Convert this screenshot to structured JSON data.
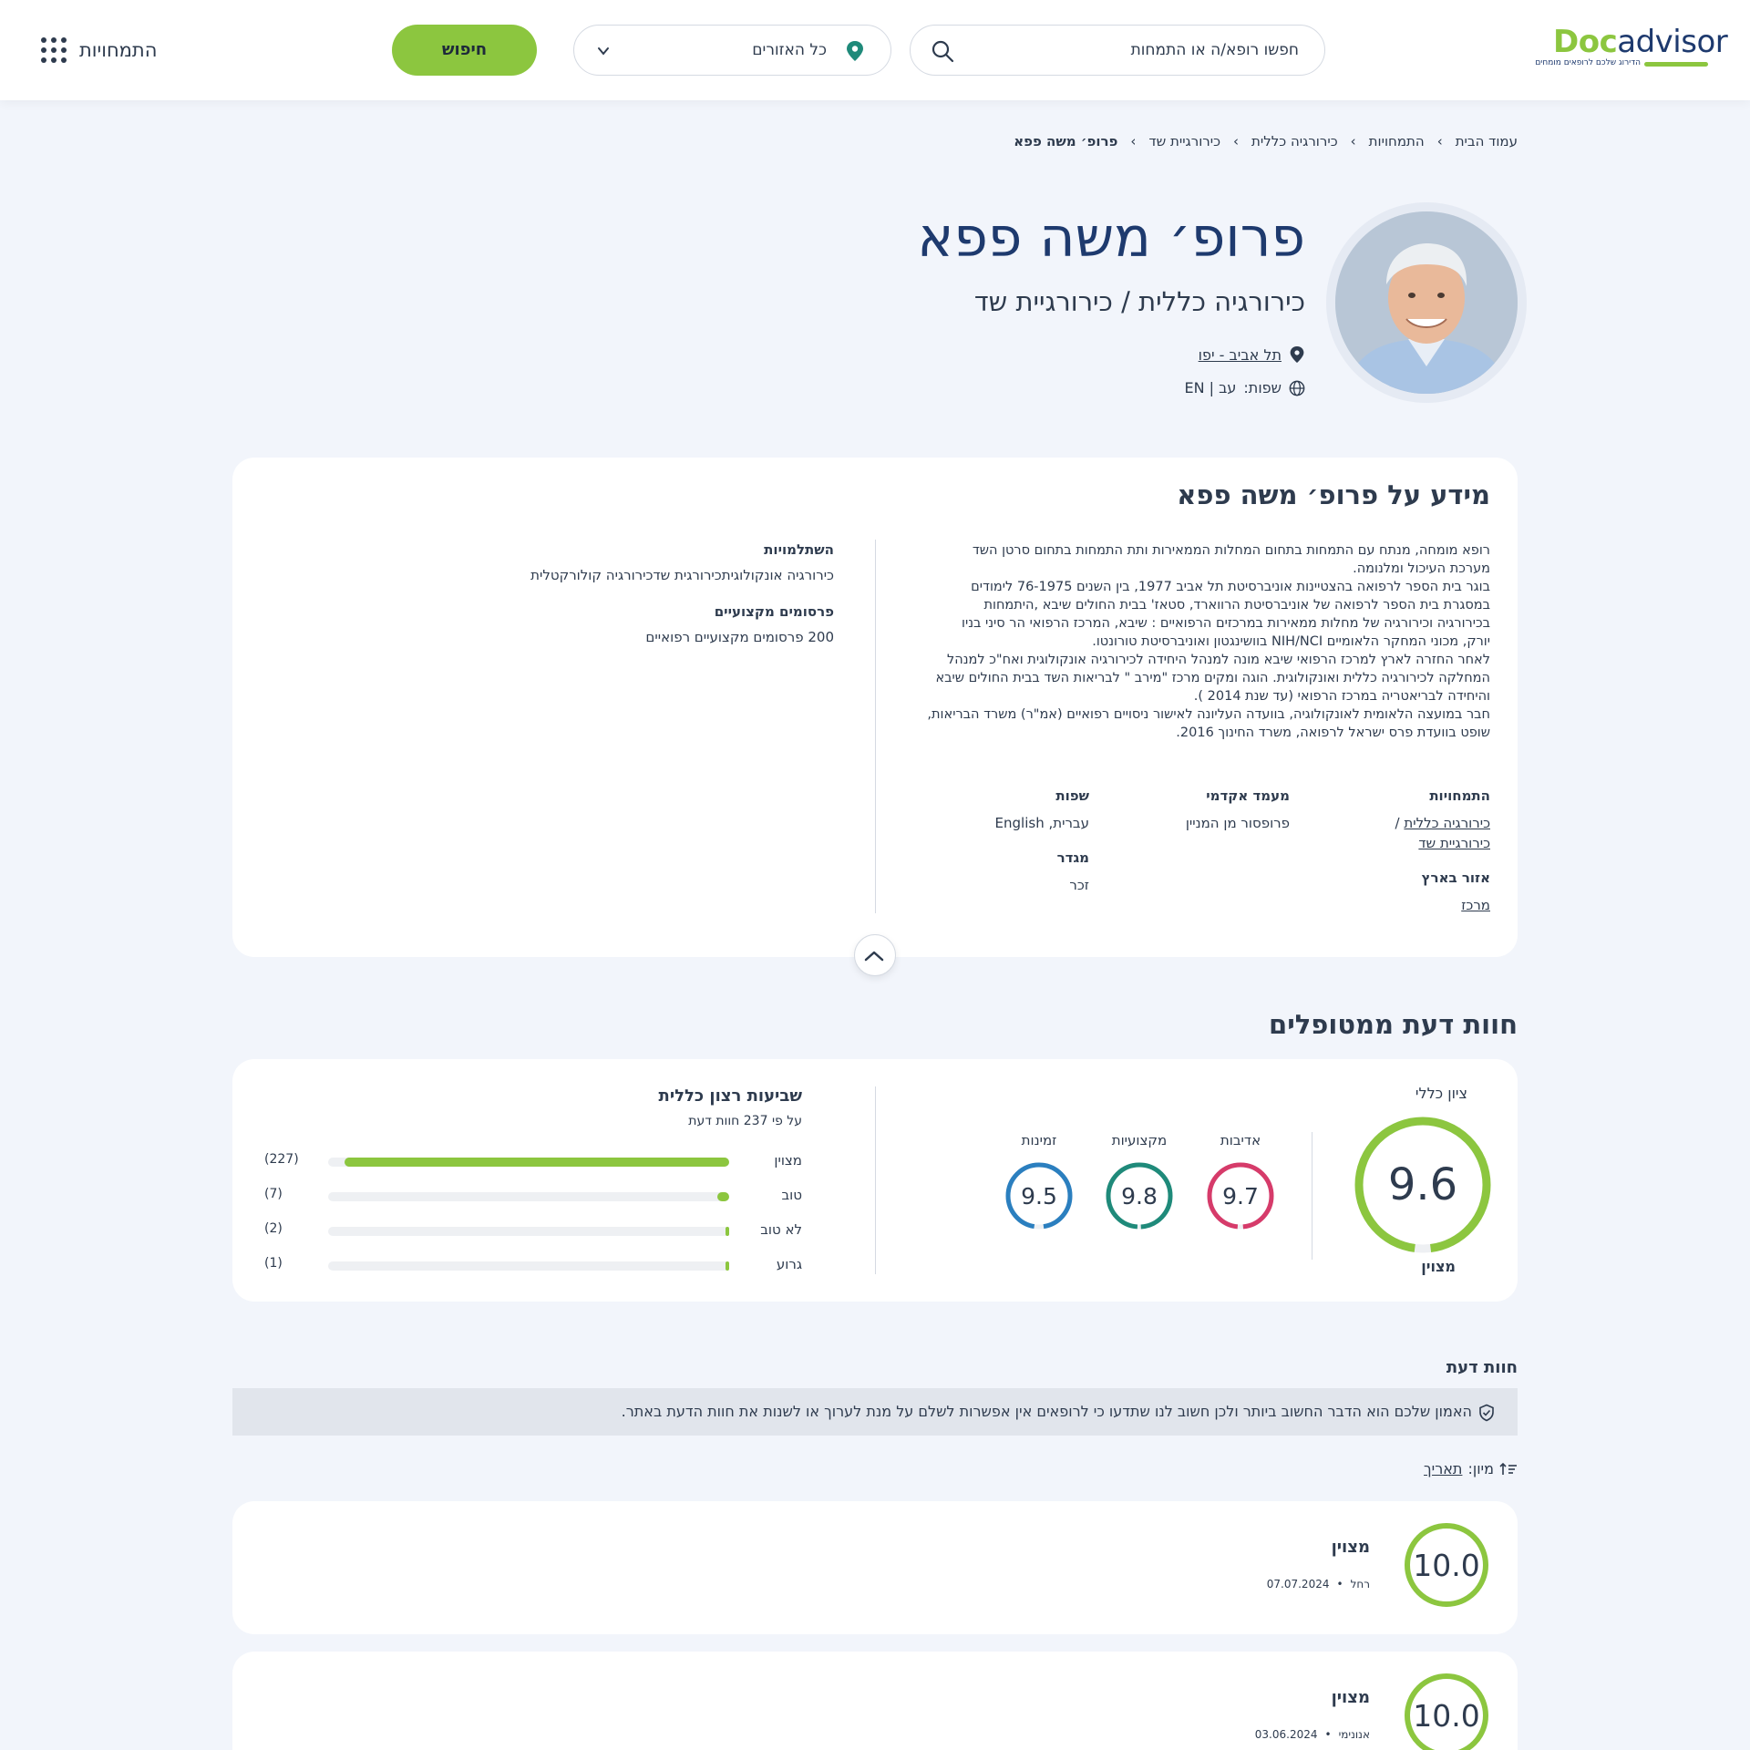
{
  "header": {
    "logo_part1": "Doc",
    "logo_part2": "advisor",
    "logo_tagline": "הדירוג שלכם לרופאים מומחים",
    "search_placeholder": "חפשו רופא/ה או התמחות",
    "region_value": "כל האזורים",
    "search_button": "חיפוש",
    "specialties_menu": "התמחויות"
  },
  "breadcrumb": [
    "עמוד הבית",
    "התמחויות",
    "כירורגיה כללית",
    "כירורגיית שד",
    "פרופ׳ משה פפא"
  ],
  "doctor": {
    "name": "פרופ׳ משה פפא",
    "specialty": "כירורגיה כללית / כירורגיית שד",
    "location": "תל אביב - יפו",
    "languages_label": "שפות:",
    "languages_value": "עב | EN"
  },
  "info": {
    "title": "מידע על פרופ׳ משה פפא",
    "bio": [
      "רופא מומחה, מנתח עם התמחות בתחום המחלות הממאירות ותת התמחות בתחום סרטן השד",
      "מערכת העיכול ומלנומה.",
      "בוגר בית הספר לרפואה בהצטיינות אוניברסיטת תל אביב 1977, בין השנים 76-1975 לימודים",
      "במסגרת בית הספר לרפואה של אוניברסיטת הרווארד, סטאז' בבית החולים שיבא ,היתמחות",
      "בכירורגיה וכירורגיה של מחלות ממאירות במרכזים הרפואיים : שיבא, המרכז הרפואי הר סיני בניו",
      "יורק, מכוני המחקר הלאומיים NIH/NCI בוושינגטון ואוניברסיטת טורונטו.",
      "לאחר החזרה לארץ למרכז הרפואי שיבא מונה למנהל היחידה לכירורגיה אונקולוגית ואח\"כ למנהל",
      "המחלקה לכירורגיה כללית ואונקולוגית. הוגה ומקים מרכז \"מירב \" לבריאות השד בבית החולים שיבא",
      "והיחידה לבריאטריה במרכז הרפואי (עד שנת 2014 ).",
      "חבר במועצה הלאומית לאונקולוגיה, בוועדה העליונה לאישור ניסויים רפואיים (אמ\"ר) משרד הבריאות,",
      "שופט בוועדת פרס ישראל לרפואה, משרד החינוך 2016."
    ],
    "training_label": "השתלמויות",
    "training_value": "כירורגיה אונקולוגיתכירורגית שדכירורגיה קולורקטלית",
    "publications_label": "פרסומים מקצועיים",
    "publications_value": "200 פרסומים מקצועיים רפואיים",
    "specialties_label": "התמחויות",
    "specialty_link1": "כירורגיה כללית",
    "specialty_sep": "/",
    "specialty_link2": "כירורגיית שד",
    "academic_label": "מעמד אקדמי",
    "academic_value": "פרופסור מן המניין",
    "languages_label": "שפות",
    "languages_value": "עברית, English",
    "region_label": "אזור בארץ",
    "region_value": "מרכז",
    "gender_label": "מגדר",
    "gender_value": "זכר"
  },
  "ratings": {
    "section_title": "חוות דעת ממטופלים",
    "overall_label": "ציון כללי",
    "overall_score": "9.6",
    "overall_fraction": 0.96,
    "overall_word": "מצוין",
    "sub_scores": [
      {
        "label": "אדיבות",
        "score": "9.7",
        "fraction": 0.97,
        "color": "#d63b6a"
      },
      {
        "label": "מקצועיות",
        "score": "9.8",
        "fraction": 0.98,
        "color": "#1f8a7a"
      },
      {
        "label": "זמינות",
        "score": "9.5",
        "fraction": 0.95,
        "color": "#2b7fbf"
      }
    ],
    "satisfaction_title": "שביעות רצון כללית",
    "satisfaction_sub": "על פי 237 חוות דעת",
    "bars": [
      {
        "label": "מצוין",
        "count": "(227)",
        "fraction": 0.958
      },
      {
        "label": "טוב",
        "count": "(7)",
        "fraction": 0.03
      },
      {
        "label": "לא טוב",
        "count": "(2)",
        "fraction": 0.009
      },
      {
        "label": "גרוע",
        "count": "(1)",
        "fraction": 0.004
      }
    ]
  },
  "opinions": {
    "title": "חוות דעת",
    "trust_text": "האמון שלכם הוא הדבר החשוב ביותר ולכן חשוב לנו שתדעו כי לרופאים אין אפשרות לשלם על מנת לערוך או לשנות את חוות הדעת באתר.",
    "sort_label": "מיון:",
    "sort_value": "תאריך",
    "reviews": [
      {
        "score": "10.0",
        "word": "מצוין",
        "author": "רחל",
        "date": "07.07.2024"
      },
      {
        "score": "10.0",
        "word": "מצוין",
        "author": "אנונימי",
        "date": "03.06.2024"
      }
    ]
  },
  "colors": {
    "brand_green": "#8cc63f",
    "brand_navy": "#1e3a6e",
    "background": "#f2f5fb"
  }
}
